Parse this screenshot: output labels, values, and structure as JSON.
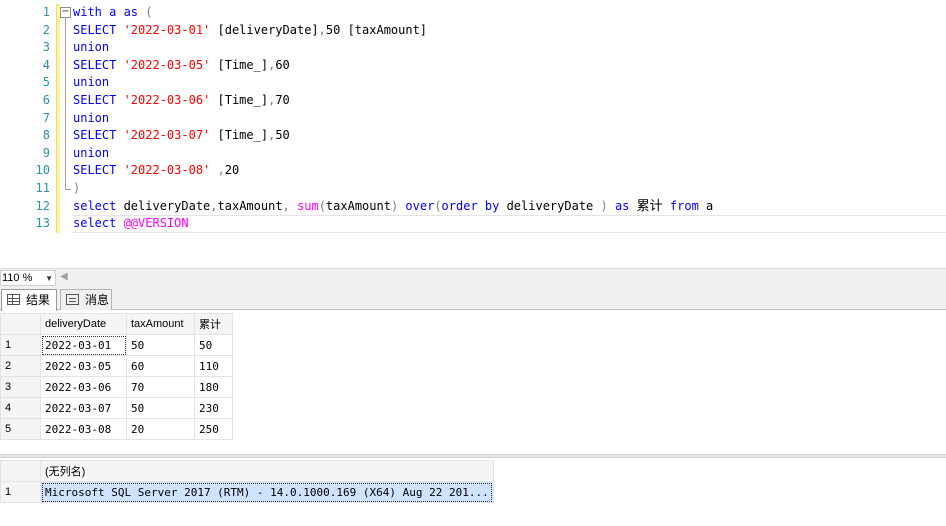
{
  "editor": {
    "line_numbers": [
      "1",
      "2",
      "3",
      "4",
      "5",
      "6",
      "7",
      "8",
      "9",
      "10",
      "11",
      "12",
      "13"
    ],
    "fold_symbol": "−",
    "lines": [
      [
        {
          "t": "with a ",
          "c": "kw"
        },
        {
          "t": "as",
          "c": "kw"
        },
        {
          "t": " ",
          "c": ""
        },
        {
          "t": "(",
          "c": "gr"
        }
      ],
      [
        {
          "t": "SELECT ",
          "c": "kw"
        },
        {
          "t": "'2022-03-01'",
          "c": "str"
        },
        {
          "t": " [deliveryDate]",
          "c": ""
        },
        {
          "t": ",",
          "c": "gr"
        },
        {
          "t": "50 [taxAmount]",
          "c": ""
        }
      ],
      [
        {
          "t": "union",
          "c": "kw"
        }
      ],
      [
        {
          "t": "SELECT ",
          "c": "kw"
        },
        {
          "t": "'2022-03-05'",
          "c": "str"
        },
        {
          "t": " [Time_]",
          "c": ""
        },
        {
          "t": ",",
          "c": "gr"
        },
        {
          "t": "60",
          "c": ""
        }
      ],
      [
        {
          "t": "union",
          "c": "kw"
        }
      ],
      [
        {
          "t": "SELECT ",
          "c": "kw"
        },
        {
          "t": "'2022-03-06'",
          "c": "str"
        },
        {
          "t": " [Time_]",
          "c": ""
        },
        {
          "t": ",",
          "c": "gr"
        },
        {
          "t": "70",
          "c": ""
        }
      ],
      [
        {
          "t": "union",
          "c": "kw"
        }
      ],
      [
        {
          "t": "SELECT ",
          "c": "kw"
        },
        {
          "t": "'2022-03-07'",
          "c": "str"
        },
        {
          "t": " [Time_]",
          "c": ""
        },
        {
          "t": ",",
          "c": "gr"
        },
        {
          "t": "50",
          "c": ""
        }
      ],
      [
        {
          "t": "union",
          "c": "kw"
        }
      ],
      [
        {
          "t": "SELECT ",
          "c": "kw"
        },
        {
          "t": "'2022-03-08'",
          "c": "str"
        },
        {
          "t": " ",
          "c": ""
        },
        {
          "t": ",",
          "c": "gr"
        },
        {
          "t": "20",
          "c": ""
        }
      ],
      [
        {
          "t": ")",
          "c": "gr"
        }
      ],
      [
        {
          "t": "select ",
          "c": "kw"
        },
        {
          "t": "deliveryDate",
          "c": ""
        },
        {
          "t": ",",
          "c": "gr"
        },
        {
          "t": "taxAmount",
          "c": ""
        },
        {
          "t": ", ",
          "c": "gr"
        },
        {
          "t": "sum",
          "c": "fn"
        },
        {
          "t": "(",
          "c": "gr"
        },
        {
          "t": "taxAmount",
          "c": ""
        },
        {
          "t": ") ",
          "c": "gr"
        },
        {
          "t": "over",
          "c": "kw"
        },
        {
          "t": "(",
          "c": "gr"
        },
        {
          "t": "order by ",
          "c": "kw"
        },
        {
          "t": "deliveryDate ",
          "c": ""
        },
        {
          "t": ") ",
          "c": "gr"
        },
        {
          "t": "as ",
          "c": "kw"
        },
        {
          "t": "累计",
          "c": "cjk"
        },
        {
          "t": " ",
          "c": ""
        },
        {
          "t": "from ",
          "c": "kw"
        },
        {
          "t": "a",
          "c": ""
        }
      ],
      [
        {
          "t": "select ",
          "c": "kw"
        },
        {
          "t": "@@VERSION",
          "c": "sys"
        }
      ]
    ]
  },
  "zoom": {
    "value": "110 %",
    "dropdown_arrow": "▼",
    "scroll_left_arrow": "◀"
  },
  "tabs": {
    "results_label": "结果",
    "messages_label": "消息"
  },
  "result1": {
    "columns": [
      "deliveryDate",
      "taxAmount",
      "累计"
    ],
    "rows": [
      {
        "n": "1",
        "cells": [
          "2022-03-01",
          "50",
          "50"
        ]
      },
      {
        "n": "2",
        "cells": [
          "2022-03-05",
          "60",
          "110"
        ]
      },
      {
        "n": "3",
        "cells": [
          "2022-03-06",
          "70",
          "180"
        ]
      },
      {
        "n": "4",
        "cells": [
          "2022-03-07",
          "50",
          "230"
        ]
      },
      {
        "n": "5",
        "cells": [
          "2022-03-08",
          "20",
          "250"
        ]
      }
    ]
  },
  "result2": {
    "column": "(无列名)",
    "rows": [
      {
        "n": "1",
        "value": "Microsoft SQL Server 2017 (RTM) - 14.0.1000.169 (X64)   Aug 22 201..."
      }
    ]
  },
  "colors": {
    "keyword": "#0000ff",
    "string": "#ff0000",
    "function": "#ff00ff",
    "line_number": "#2b91af",
    "selection": "#cfe3ff"
  }
}
